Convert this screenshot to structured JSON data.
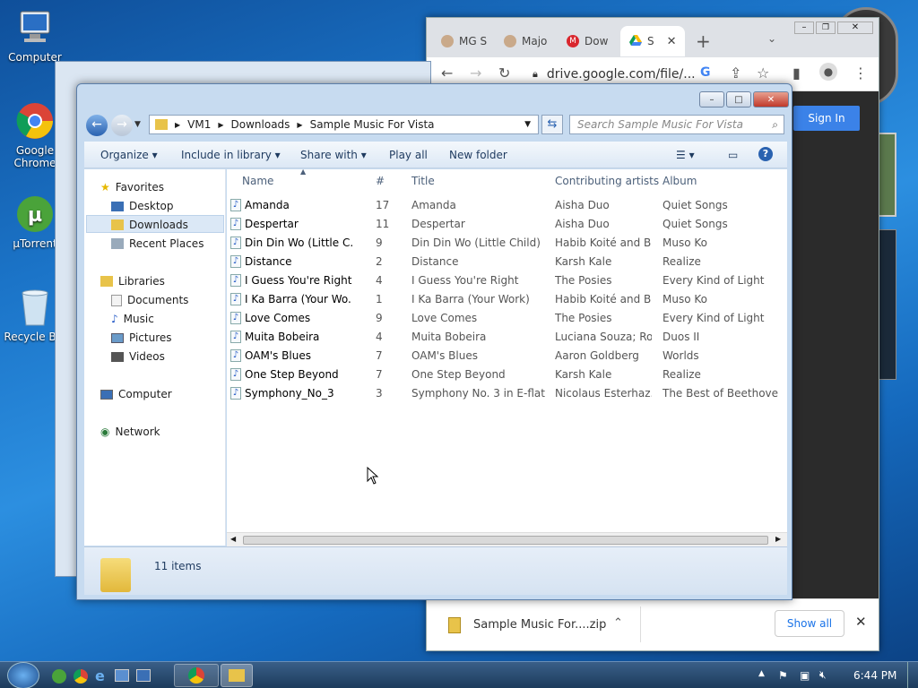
{
  "desktop": {
    "icons": [
      {
        "label": "Computer",
        "icon": "computer-icon"
      },
      {
        "label": "Google Chrome",
        "icon": "chrome-icon"
      },
      {
        "label": "µTorrent",
        "icon": "utorrent-icon"
      },
      {
        "label": "Recycle Bin",
        "icon": "recycle-bin-icon"
      }
    ]
  },
  "chrome": {
    "tabs": [
      {
        "label": "MG S",
        "icon": "avatar-icon"
      },
      {
        "label": "Majo",
        "icon": "avatar-icon"
      },
      {
        "label": "Dow",
        "icon": "mega-icon"
      },
      {
        "label": "S",
        "icon": "google-drive-icon"
      }
    ],
    "new_tab": "+",
    "url": "drive.google.com/file/...",
    "sign_in": "Sign In",
    "download": {
      "filename": "Sample Music For....zip",
      "show_all": "Show all"
    }
  },
  "explorer": {
    "breadcrumb": [
      "VM1",
      "Downloads",
      "Sample Music For Vista"
    ],
    "search_placeholder": "Search Sample Music For Vista",
    "toolbar": {
      "organize": "Organize",
      "include_in_library": "Include in library",
      "share_with": "Share with",
      "play_all": "Play all",
      "new_folder": "New folder"
    },
    "nav": {
      "favorites": "Favorites",
      "favorites_items": [
        "Desktop",
        "Downloads",
        "Recent Places"
      ],
      "selected": "Downloads",
      "libraries": "Libraries",
      "libraries_items": [
        "Documents",
        "Music",
        "Pictures",
        "Videos"
      ],
      "computer": "Computer",
      "network": "Network"
    },
    "columns": [
      "Name",
      "#",
      "Title",
      "Contributing artists",
      "Album"
    ],
    "files": [
      {
        "name": "Amanda",
        "num": "17",
        "title": "Amanda",
        "artist": "Aisha Duo",
        "album": "Quiet Songs"
      },
      {
        "name": "Despertar",
        "num": "11",
        "title": "Despertar",
        "artist": "Aisha Duo",
        "album": "Quiet Songs"
      },
      {
        "name": "Din Din Wo (Little C...",
        "num": "9",
        "title": "Din Din Wo (Little Child)",
        "artist": "Habib Koité and B...",
        "album": "Muso Ko"
      },
      {
        "name": "Distance",
        "num": "2",
        "title": "Distance",
        "artist": "Karsh Kale",
        "album": "Realize"
      },
      {
        "name": "I Guess You're Right",
        "num": "4",
        "title": "I Guess You're Right",
        "artist": "The Posies",
        "album": "Every Kind of Light"
      },
      {
        "name": "I Ka Barra (Your Wo...",
        "num": "1",
        "title": "I Ka Barra (Your Work)",
        "artist": "Habib Koité and B...",
        "album": "Muso Ko"
      },
      {
        "name": "Love Comes",
        "num": "9",
        "title": "Love Comes",
        "artist": "The Posies",
        "album": "Every Kind of Light"
      },
      {
        "name": "Muita Bobeira",
        "num": "4",
        "title": "Muita Bobeira",
        "artist": "Luciana Souza; Ro...",
        "album": "Duos II"
      },
      {
        "name": "OAM's Blues",
        "num": "7",
        "title": "OAM's Blues",
        "artist": "Aaron Goldberg",
        "album": "Worlds"
      },
      {
        "name": "One Step Beyond",
        "num": "7",
        "title": "One Step Beyond",
        "artist": "Karsh Kale",
        "album": "Realize"
      },
      {
        "name": "Symphony_No_3",
        "num": "3",
        "title": "Symphony No. 3 in E-flat ...",
        "artist": "Nicolaus Esterhaz...",
        "album": "The Best of Beethoven"
      }
    ],
    "item_count": "11 items"
  },
  "taskbar": {
    "clock": "6:44 PM"
  }
}
